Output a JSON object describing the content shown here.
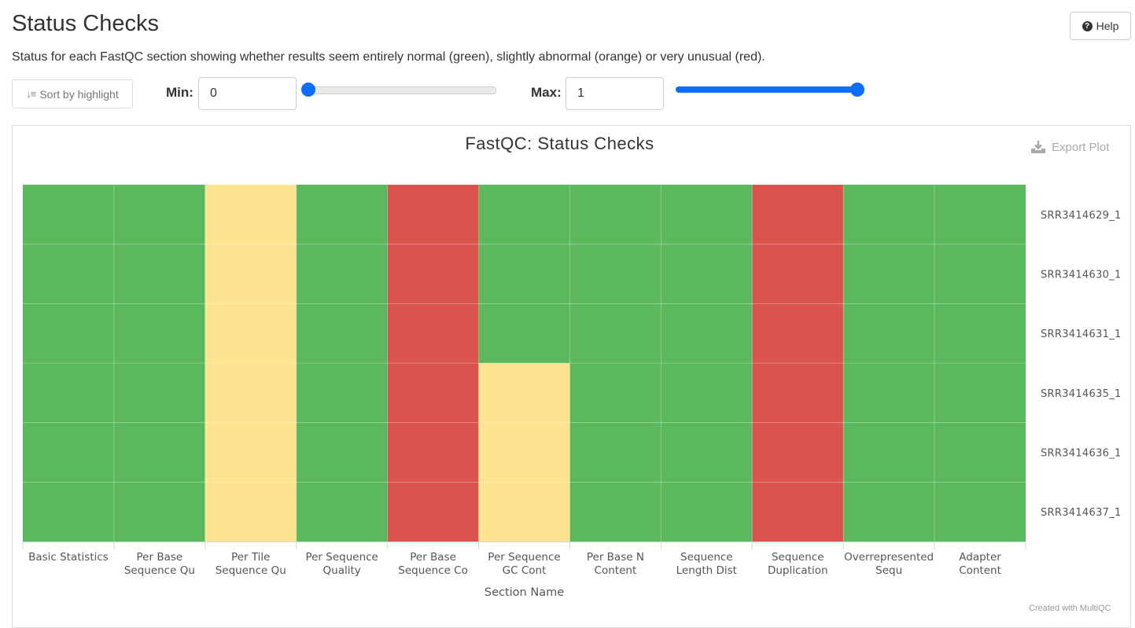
{
  "header": {
    "title": "Status Checks",
    "help_label": "Help",
    "description": "Status for each FastQC section showing whether results seem entirely normal (green), slightly abnormal (orange) or very unusual (red)."
  },
  "controls": {
    "sort_label": "Sort by highlight",
    "min_label": "Min:",
    "min_value": "0",
    "max_label": "Max:",
    "max_value": "1",
    "min_slider_level": 0,
    "max_slider_level": 1
  },
  "plot": {
    "export_label": "Export Plot",
    "credit": "Created with MultiQC"
  },
  "colors": {
    "pass": "#5cb85c",
    "warn": "#fee391",
    "fail": "#d9534f",
    "accent": "#0d6efd"
  },
  "chart_data": {
    "type": "heatmap",
    "title": "FastQC: Status Checks",
    "xlabel": "Section Name",
    "ylabel": "",
    "x_categories": [
      [
        "Basic Statistics"
      ],
      [
        "Per Base",
        "Sequence Qu"
      ],
      [
        "Per Tile",
        "Sequence Qu"
      ],
      [
        "Per Sequence",
        "Quality"
      ],
      [
        "Per Base",
        "Sequence Co"
      ],
      [
        "Per Sequence",
        "GC Cont"
      ],
      [
        "Per Base N",
        "Content"
      ],
      [
        "Sequence",
        "Length Dist"
      ],
      [
        "Sequence",
        "Duplication"
      ],
      [
        "Overrepresented",
        "Sequ"
      ],
      [
        "Adapter",
        "Content"
      ]
    ],
    "y_categories": [
      "SRR3414629_1",
      "SRR3414630_1",
      "SRR3414631_1",
      "SRR3414635_1",
      "SRR3414636_1",
      "SRR3414637_1"
    ],
    "values": [
      [
        1,
        1,
        0.5,
        1,
        0,
        1,
        1,
        1,
        0,
        1,
        1
      ],
      [
        1,
        1,
        0.5,
        1,
        0,
        1,
        1,
        1,
        0,
        1,
        1
      ],
      [
        1,
        1,
        0.5,
        1,
        0,
        1,
        1,
        1,
        0,
        1,
        1
      ],
      [
        1,
        1,
        0.5,
        1,
        0,
        0.5,
        1,
        1,
        0,
        1,
        1
      ],
      [
        1,
        1,
        0.5,
        1,
        0,
        0.5,
        1,
        1,
        0,
        1,
        1
      ],
      [
        1,
        1,
        0.5,
        1,
        0,
        0.5,
        1,
        1,
        0,
        1,
        1
      ]
    ],
    "value_range": [
      0,
      1
    ],
    "grid": true
  }
}
